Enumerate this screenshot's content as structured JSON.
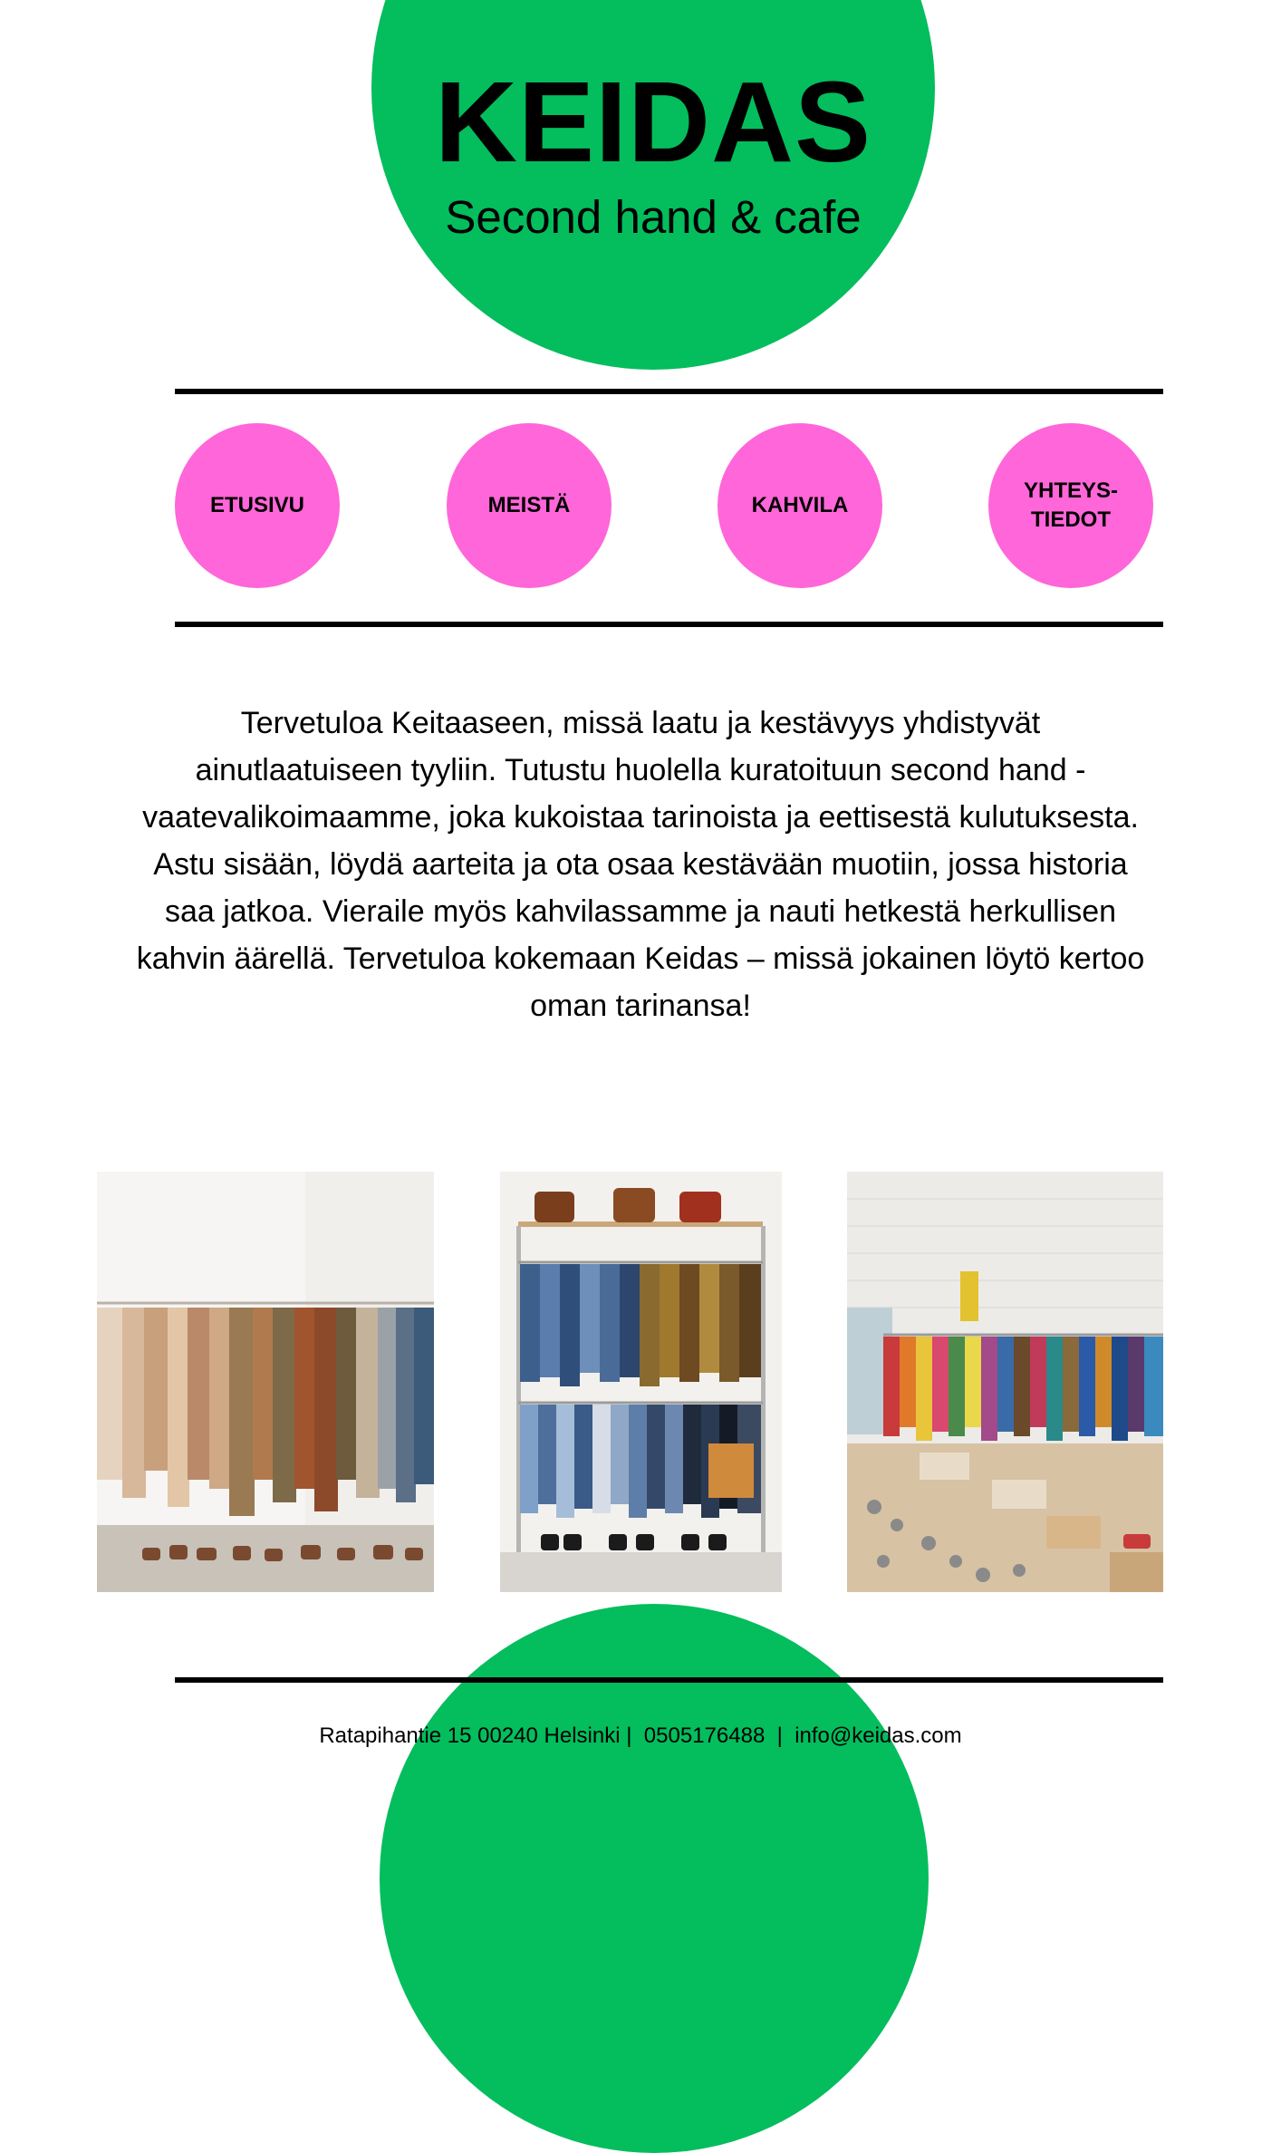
{
  "brand": {
    "title": "KEIDAS",
    "subtitle": "Second hand & cafe"
  },
  "nav": {
    "items": [
      {
        "label": "ETUSIVU"
      },
      {
        "label": "MEISTÄ"
      },
      {
        "label": "KAHVILA"
      },
      {
        "label": "YHTEYS-\nTIEDOT"
      }
    ]
  },
  "intro": {
    "text": "Tervetuloa Keitaaseen, missä laatu ja kestävyys yhdistyvät ainutlaatuiseen tyyliin. Tutustu huolella kuratoituun second hand -vaatevalikoimaamme, joka kukoistaa tarinoista ja eettisestä kulutuksesta. Astu sisään, löydä aarteita ja ota osaa kestävään muotiin, jossa historia saa jatkoa. Vieraile myös kahvilassamme ja nauti hetkestä herkullisen kahvin äärellä. Tervetuloa kokemaan Keidas – missä jokainen löytö kertoo oman tarinansa!"
  },
  "footer": {
    "text": "Ratapihantie 15 00240 Helsinki |  0505176488  |  info@keidas.com"
  },
  "colors": {
    "green": "#04BD5D",
    "pink": "#FF66D9",
    "black": "#000000"
  }
}
